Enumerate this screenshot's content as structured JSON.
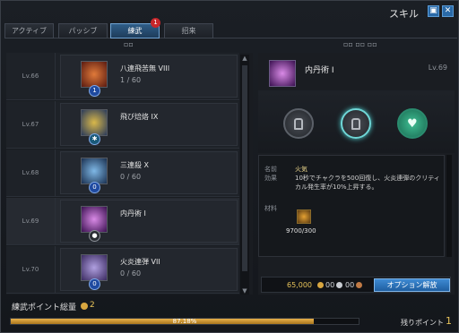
{
  "window": {
    "title": "スキル"
  },
  "tabs": [
    {
      "label": "アクティブ",
      "active": false
    },
    {
      "label": "パッシブ",
      "active": false
    },
    {
      "label": "練武",
      "active": true,
      "badge": "1"
    },
    {
      "label": "招来",
      "active": false
    }
  ],
  "skills": [
    {
      "level": "Lv.66",
      "name": "八連飛苦無 VIII",
      "count": "1 / 60",
      "badge": "1",
      "icon_color": "#b4502a"
    },
    {
      "level": "Lv.67",
      "name": "飛び焙烙 IX",
      "count": "",
      "badge": "",
      "icon_color": "#7a7a2a"
    },
    {
      "level": "Lv.68",
      "name": "三連殺 X",
      "count": "0 / 60",
      "badge": "0",
      "icon_color": "#3a6a9a"
    },
    {
      "level": "Lv.69",
      "name": "内丹術 I",
      "count": "",
      "badge": "",
      "icon_color": "#8a3ab8"
    },
    {
      "level": "Lv.70",
      "name": "火炎連弾 VII",
      "count": "0 / 60",
      "badge": "0",
      "icon_color": "#5a3a8a"
    }
  ],
  "detail": {
    "name": "内丹術 I",
    "level": "Lv.69",
    "name_label": "名前",
    "effect_label": "効果",
    "skill_name": "火気",
    "effect": "10秒でチャクラを500回復し、火炎連弾のクリティカル発生率が10%上昇する。",
    "material_label": "材料",
    "material_count": "9700/300"
  },
  "cost": {
    "gold": "65,000",
    "silver": "00",
    "copper": "00"
  },
  "unlock_button": "オプション解放",
  "footer": {
    "points_label": "練武ポイント総量",
    "points_value": "2",
    "progress_text": "87.18%",
    "progress": 0.8718,
    "remaining_label": "残りポイント",
    "remaining_value": "1"
  },
  "colors": {
    "accent": "#3e8ad3",
    "gold": "#e8c45a",
    "active_tab": "#2f5d88"
  }
}
